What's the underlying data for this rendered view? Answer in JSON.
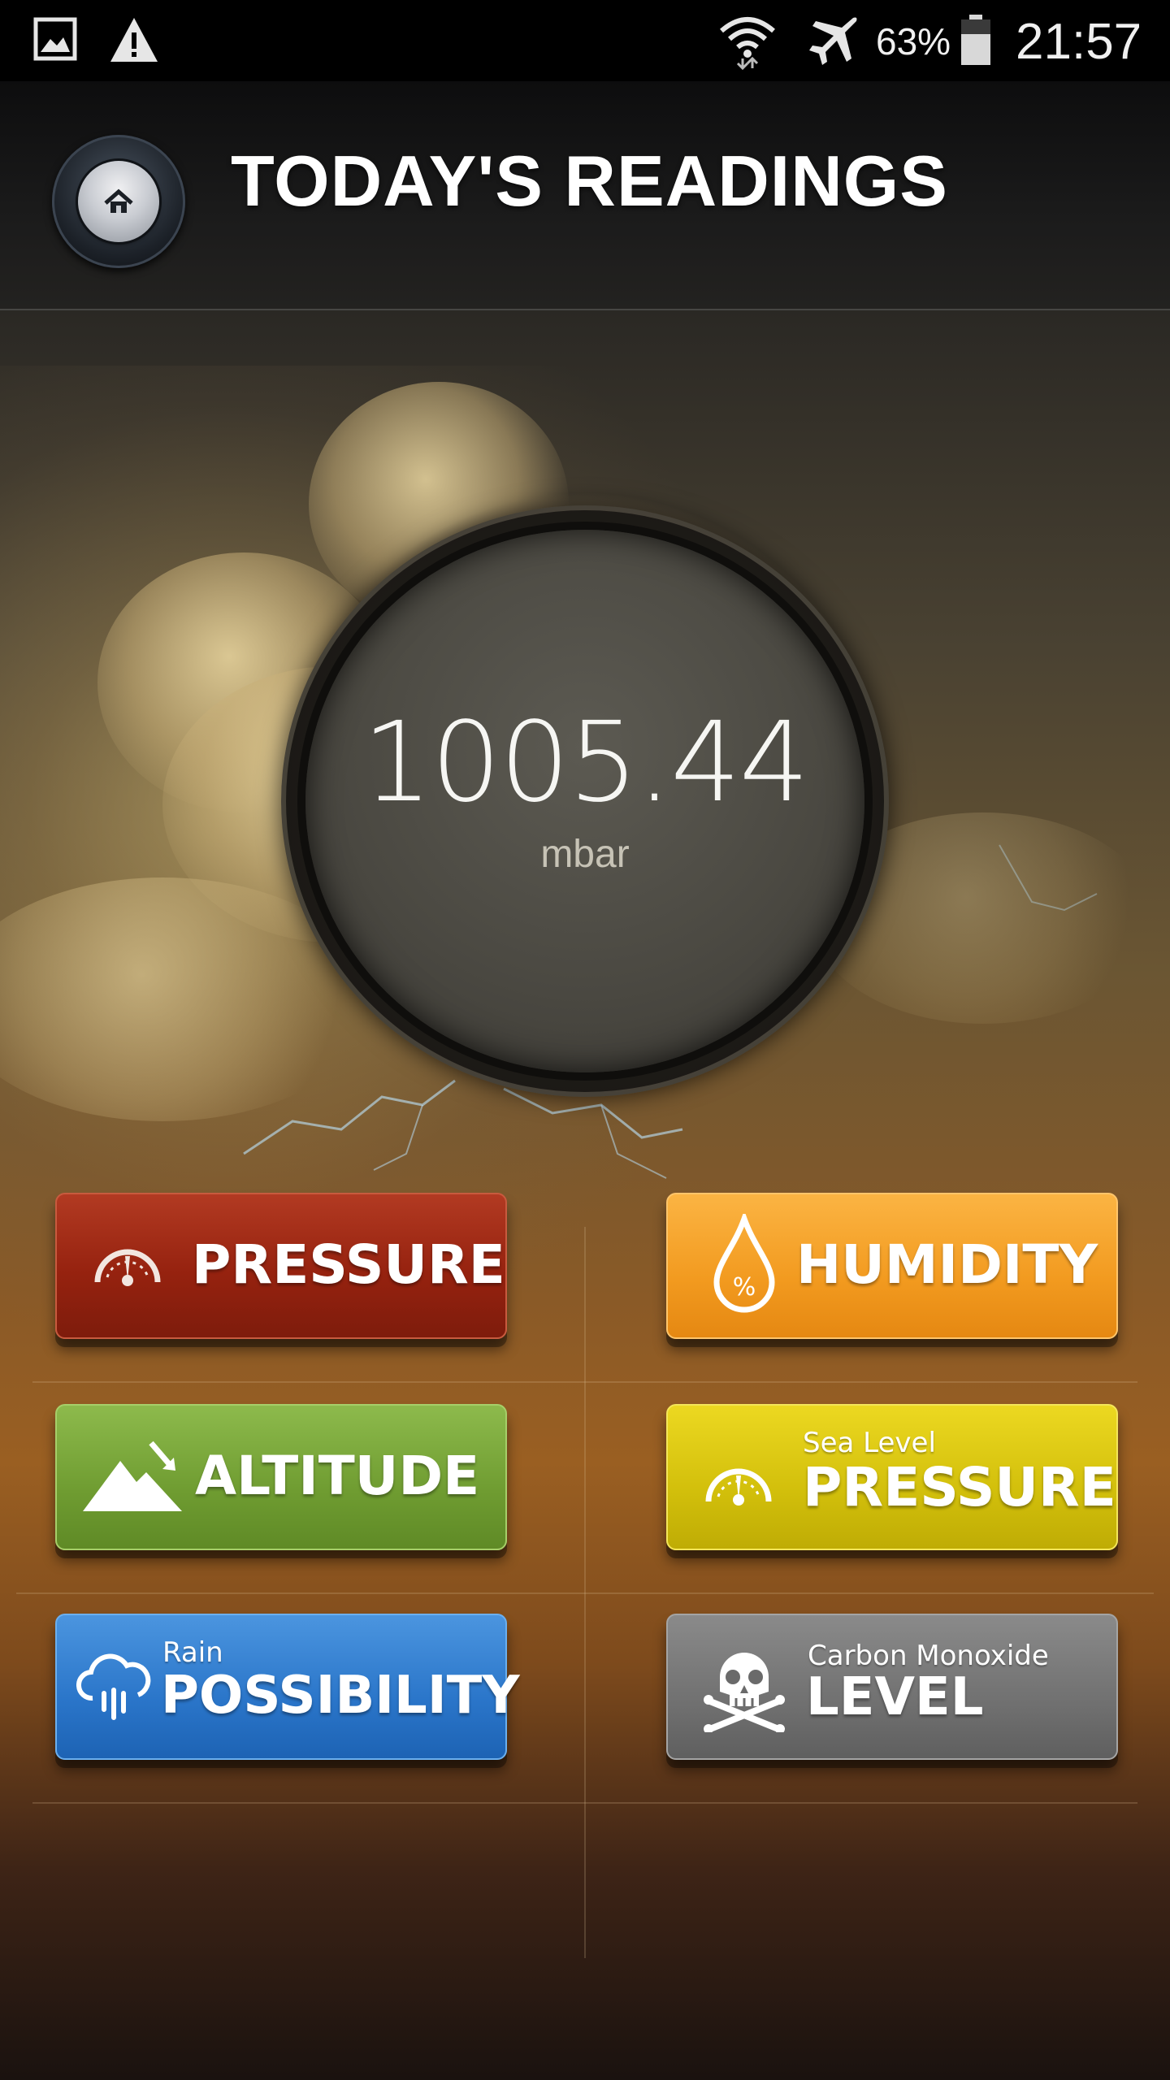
{
  "status_bar": {
    "icons": [
      "gallery-icon",
      "warning-icon",
      "wifi-icon",
      "airplane-mode-icon",
      "battery-icon"
    ],
    "battery": "63%",
    "time": "21:57"
  },
  "header": {
    "title": "TODAY'S READINGS",
    "home_icon": "home-icon"
  },
  "gauge": {
    "value": "1005.44",
    "unit": "mbar"
  },
  "buttons": {
    "pressure": {
      "label": "PRESSURE",
      "icon": "gauge-icon",
      "color": "#9b2a14"
    },
    "humidity": {
      "label": "HUMIDITY",
      "icon": "water-drop-percent-icon",
      "color": "#f39a20"
    },
    "altitude": {
      "label": "ALTITUDE",
      "icon": "mountain-icon",
      "color": "#6f9c31"
    },
    "sea_level_pressure": {
      "sublabel": "Sea Level",
      "label": "PRESSURE",
      "icon": "gauge-icon",
      "color": "#d2bf0b"
    },
    "rain_possibility": {
      "sublabel": "Rain",
      "label": "POSSIBILITY",
      "icon": "rain-cloud-icon",
      "color": "#2a75c9"
    },
    "carbon_monoxide_level": {
      "sublabel": "Carbon Monoxide",
      "label": "LEVEL",
      "icon": "skull-crossbones-icon",
      "color": "#717171"
    }
  }
}
